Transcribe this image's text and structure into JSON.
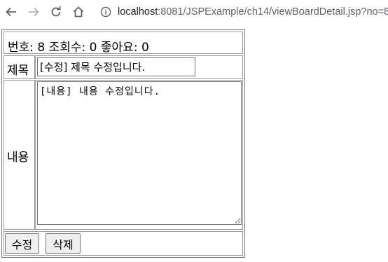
{
  "browser": {
    "url_host": "localhost",
    "url_path": ":8081/JSPExample/ch14/viewBoardDetail.jsp?no=8"
  },
  "board": {
    "meta": "번호: 8 조회수: 0 좋아요: 0",
    "title_label": "제목",
    "title_value": "[수정] 제목 수정입니다.",
    "content_label": "내용",
    "content_value": "[내용] 내용 수정입니다.",
    "edit_button": "수정",
    "delete_button": "삭제"
  }
}
